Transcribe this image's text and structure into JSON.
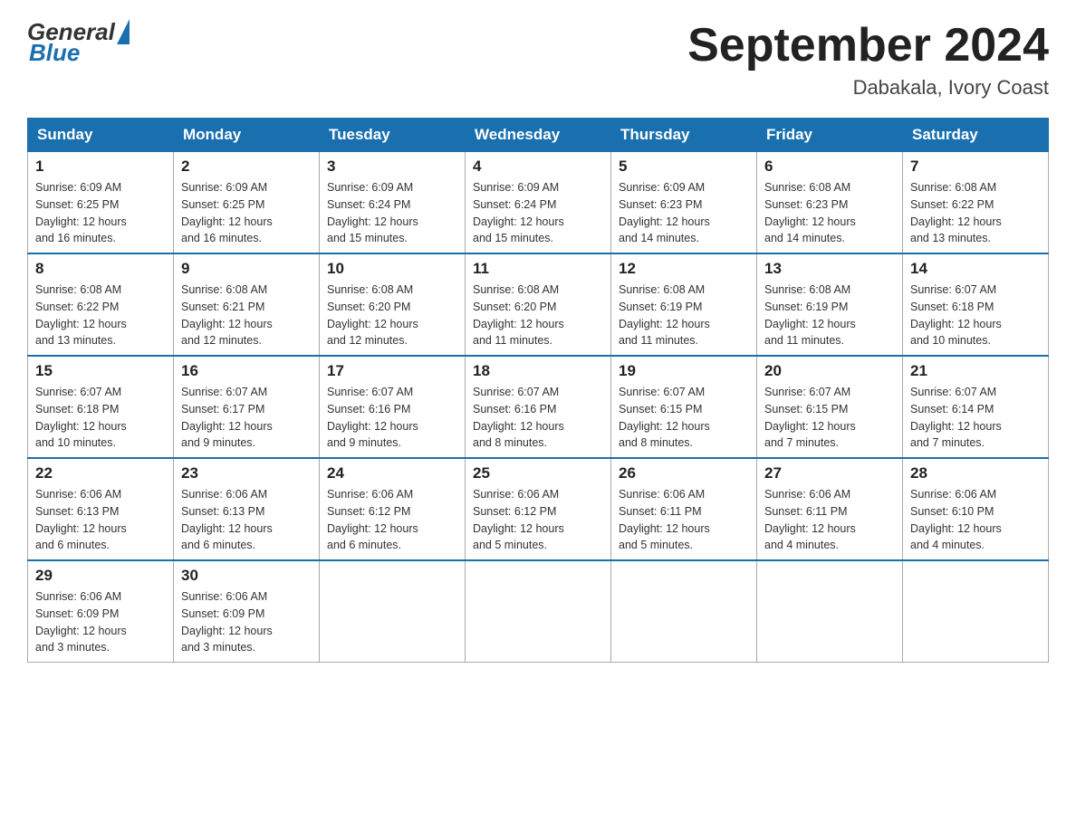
{
  "header": {
    "logo_general": "General",
    "logo_blue": "Blue",
    "month_title": "September 2024",
    "location": "Dabakala, Ivory Coast"
  },
  "days_of_week": [
    "Sunday",
    "Monday",
    "Tuesday",
    "Wednesday",
    "Thursday",
    "Friday",
    "Saturday"
  ],
  "weeks": [
    [
      {
        "day": "1",
        "sunrise": "6:09 AM",
        "sunset": "6:25 PM",
        "daylight": "12 hours and 16 minutes."
      },
      {
        "day": "2",
        "sunrise": "6:09 AM",
        "sunset": "6:25 PM",
        "daylight": "12 hours and 16 minutes."
      },
      {
        "day": "3",
        "sunrise": "6:09 AM",
        "sunset": "6:24 PM",
        "daylight": "12 hours and 15 minutes."
      },
      {
        "day": "4",
        "sunrise": "6:09 AM",
        "sunset": "6:24 PM",
        "daylight": "12 hours and 15 minutes."
      },
      {
        "day": "5",
        "sunrise": "6:09 AM",
        "sunset": "6:23 PM",
        "daylight": "12 hours and 14 minutes."
      },
      {
        "day": "6",
        "sunrise": "6:08 AM",
        "sunset": "6:23 PM",
        "daylight": "12 hours and 14 minutes."
      },
      {
        "day": "7",
        "sunrise": "6:08 AM",
        "sunset": "6:22 PM",
        "daylight": "12 hours and 13 minutes."
      }
    ],
    [
      {
        "day": "8",
        "sunrise": "6:08 AM",
        "sunset": "6:22 PM",
        "daylight": "12 hours and 13 minutes."
      },
      {
        "day": "9",
        "sunrise": "6:08 AM",
        "sunset": "6:21 PM",
        "daylight": "12 hours and 12 minutes."
      },
      {
        "day": "10",
        "sunrise": "6:08 AM",
        "sunset": "6:20 PM",
        "daylight": "12 hours and 12 minutes."
      },
      {
        "day": "11",
        "sunrise": "6:08 AM",
        "sunset": "6:20 PM",
        "daylight": "12 hours and 11 minutes."
      },
      {
        "day": "12",
        "sunrise": "6:08 AM",
        "sunset": "6:19 PM",
        "daylight": "12 hours and 11 minutes."
      },
      {
        "day": "13",
        "sunrise": "6:08 AM",
        "sunset": "6:19 PM",
        "daylight": "12 hours and 11 minutes."
      },
      {
        "day": "14",
        "sunrise": "6:07 AM",
        "sunset": "6:18 PM",
        "daylight": "12 hours and 10 minutes."
      }
    ],
    [
      {
        "day": "15",
        "sunrise": "6:07 AM",
        "sunset": "6:18 PM",
        "daylight": "12 hours and 10 minutes."
      },
      {
        "day": "16",
        "sunrise": "6:07 AM",
        "sunset": "6:17 PM",
        "daylight": "12 hours and 9 minutes."
      },
      {
        "day": "17",
        "sunrise": "6:07 AM",
        "sunset": "6:16 PM",
        "daylight": "12 hours and 9 minutes."
      },
      {
        "day": "18",
        "sunrise": "6:07 AM",
        "sunset": "6:16 PM",
        "daylight": "12 hours and 8 minutes."
      },
      {
        "day": "19",
        "sunrise": "6:07 AM",
        "sunset": "6:15 PM",
        "daylight": "12 hours and 8 minutes."
      },
      {
        "day": "20",
        "sunrise": "6:07 AM",
        "sunset": "6:15 PM",
        "daylight": "12 hours and 7 minutes."
      },
      {
        "day": "21",
        "sunrise": "6:07 AM",
        "sunset": "6:14 PM",
        "daylight": "12 hours and 7 minutes."
      }
    ],
    [
      {
        "day": "22",
        "sunrise": "6:06 AM",
        "sunset": "6:13 PM",
        "daylight": "12 hours and 6 minutes."
      },
      {
        "day": "23",
        "sunrise": "6:06 AM",
        "sunset": "6:13 PM",
        "daylight": "12 hours and 6 minutes."
      },
      {
        "day": "24",
        "sunrise": "6:06 AM",
        "sunset": "6:12 PM",
        "daylight": "12 hours and 6 minutes."
      },
      {
        "day": "25",
        "sunrise": "6:06 AM",
        "sunset": "6:12 PM",
        "daylight": "12 hours and 5 minutes."
      },
      {
        "day": "26",
        "sunrise": "6:06 AM",
        "sunset": "6:11 PM",
        "daylight": "12 hours and 5 minutes."
      },
      {
        "day": "27",
        "sunrise": "6:06 AM",
        "sunset": "6:11 PM",
        "daylight": "12 hours and 4 minutes."
      },
      {
        "day": "28",
        "sunrise": "6:06 AM",
        "sunset": "6:10 PM",
        "daylight": "12 hours and 4 minutes."
      }
    ],
    [
      {
        "day": "29",
        "sunrise": "6:06 AM",
        "sunset": "6:09 PM",
        "daylight": "12 hours and 3 minutes."
      },
      {
        "day": "30",
        "sunrise": "6:06 AM",
        "sunset": "6:09 PM",
        "daylight": "12 hours and 3 minutes."
      },
      null,
      null,
      null,
      null,
      null
    ]
  ],
  "labels": {
    "sunrise": "Sunrise:",
    "sunset": "Sunset:",
    "daylight": "Daylight:"
  }
}
